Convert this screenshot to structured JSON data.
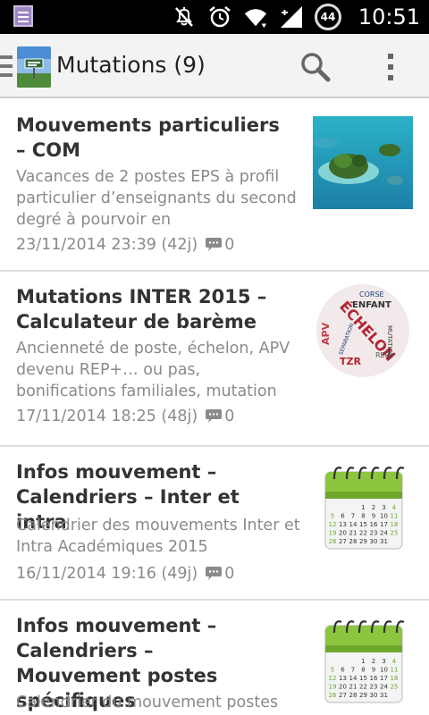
{
  "status_bar": {
    "time": "10:51",
    "battery": "44",
    "icons": [
      "notification-icon",
      "mute-icon",
      "alarm-icon",
      "wifi-icon",
      "signal-icon",
      "battery-icon"
    ]
  },
  "action_bar": {
    "title": "Mutations (9)",
    "icons": [
      "drawer-menu-icon",
      "app-logo",
      "search-icon",
      "overflow-menu-icon"
    ]
  },
  "articles": [
    {
      "title": "Mouvements particuliers – COM",
      "excerpt": "Vacances de 2 postes EPS à profil particulier d’enseignants du second degré à pourvoir en",
      "date": "23/11/2014 23:39 (42j)",
      "comments": "0",
      "thumbnail": "island-photo"
    },
    {
      "title": "Mutations INTER 2015 – Calculateur de barème",
      "excerpt": "Ancienneté de poste, échelon, APV devenu REP+… ou pas, bonifications familiales, mutation",
      "date": "17/11/2014 18:25 (48j)",
      "comments": "0",
      "thumbnail": "word-cloud"
    },
    {
      "title": "Infos mouvement – Calendriers – Inter et intra",
      "excerpt": "Calendrier des mouvements Inter et Intra Académiques 2015",
      "date": "16/11/2014 19:16 (49j)",
      "comments": "0",
      "thumbnail": "calendar-icon"
    },
    {
      "title": "Infos mouvement – Calendriers – Mouvement postes spécifiques",
      "excerpt": "Calendrier du mouvement postes",
      "thumbnail": "calendar-icon"
    }
  ],
  "word_cloud": {
    "words": [
      "ÉCHELON",
      "ENFANT",
      "CORSE",
      "APV",
      "TZR",
      "REP+",
      "SÉPARATION",
      "MUTATION"
    ]
  },
  "calendar_days": [
    "1",
    "2",
    "3",
    "4",
    "5",
    "6",
    "7",
    "8",
    "9",
    "10",
    "11",
    "12",
    "13",
    "14",
    "15",
    "16",
    "17",
    "18",
    "19",
    "20",
    "21",
    "22",
    "23",
    "24",
    "25",
    "26",
    "27",
    "28",
    "29",
    "30",
    "31"
  ]
}
